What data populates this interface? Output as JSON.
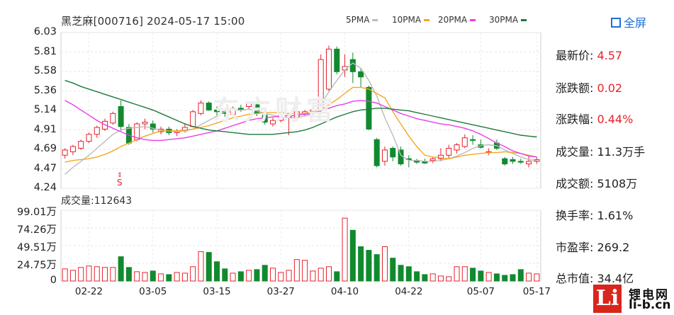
{
  "header": {
    "title": "黑芝麻[000716] 2024-05-17 15:00",
    "legend": [
      {
        "label": "5PMA",
        "color": "#bbbbbb"
      },
      {
        "label": "10PMA",
        "color": "#f5a623"
      },
      {
        "label": "20PMA",
        "color": "#e83ee8"
      },
      {
        "label": "30PMA",
        "color": "#1d7a3a"
      }
    ],
    "fullscreen_label": "全屏"
  },
  "watermark": "东方财富",
  "marker": "S",
  "stats": [
    {
      "label": "最新价:",
      "value": "4.57",
      "red": true
    },
    {
      "label": "涨跌额:",
      "value": "0.02",
      "red": true
    },
    {
      "label": "涨跌幅:",
      "value": "0.44%",
      "red": true
    },
    {
      "label": "成交量:",
      "value": "11.3万手",
      "red": false
    },
    {
      "label": "成交额:",
      "value": "5108万",
      "red": false
    },
    {
      "label": "换手率:",
      "value": "1.61%",
      "red": false
    },
    {
      "label": "市盈率:",
      "value": "269.2",
      "red": false
    },
    {
      "label": "总市值:",
      "value": "34.4亿",
      "red": false
    }
  ],
  "volume_title": "成交量:112643",
  "logo": {
    "glyph": "Li",
    "line1": "锂电网",
    "line2": "li-b.cn"
  },
  "chart_data": [
    {
      "type": "candlestick",
      "x_tick_labels": [
        "02-22",
        "03-05",
        "03-15",
        "03-27",
        "04-10",
        "04-22",
        "05-07",
        "05-17"
      ],
      "x_tick_index": [
        3,
        11,
        19,
        27,
        35,
        43,
        52,
        59
      ],
      "y_tick_labels": [
        "6.03",
        "5.81",
        "5.58",
        "5.36",
        "5.14",
        "4.91",
        "4.69",
        "4.47",
        "4.24"
      ],
      "ylim": [
        4.24,
        6.03
      ],
      "up_color": "#e8202a",
      "down_color": "#118a2e",
      "candles": [
        [
          4.62,
          4.7,
          4.58,
          4.68
        ],
        [
          4.66,
          4.74,
          4.62,
          4.72
        ],
        [
          4.7,
          4.8,
          4.68,
          4.78
        ],
        [
          4.78,
          4.88,
          4.76,
          4.86
        ],
        [
          4.86,
          4.96,
          4.82,
          4.94
        ],
        [
          4.92,
          5.04,
          4.9,
          5.01
        ],
        [
          4.99,
          5.12,
          4.97,
          5.1
        ],
        [
          5.18,
          5.25,
          4.9,
          4.95
        ],
        [
          4.94,
          4.98,
          4.74,
          4.76
        ],
        [
          4.8,
          5.0,
          4.78,
          4.98
        ],
        [
          4.98,
          5.04,
          4.92,
          5.0
        ],
        [
          4.98,
          5.02,
          4.88,
          4.92
        ],
        [
          4.89,
          4.95,
          4.86,
          4.92
        ],
        [
          4.92,
          4.95,
          4.85,
          4.88
        ],
        [
          4.88,
          4.92,
          4.84,
          4.9
        ],
        [
          4.9,
          4.99,
          4.88,
          4.94
        ],
        [
          4.95,
          5.14,
          4.94,
          5.12
        ],
        [
          5.1,
          5.25,
          5.08,
          5.22
        ],
        [
          5.22,
          5.24,
          5.13,
          5.14
        ],
        [
          5.14,
          5.18,
          5.05,
          5.12
        ],
        [
          5.12,
          5.16,
          5.06,
          5.1
        ],
        [
          5.09,
          5.18,
          5.08,
          5.16
        ],
        [
          5.16,
          5.2,
          5.12,
          5.14
        ],
        [
          5.18,
          5.24,
          5.15,
          5.22
        ],
        [
          5.2,
          5.22,
          5.07,
          5.1
        ],
        [
          5.08,
          5.12,
          4.97,
          5.0
        ],
        [
          4.98,
          5.05,
          4.95,
          5.02
        ],
        [
          5.02,
          5.1,
          5.0,
          5.06
        ],
        [
          5.06,
          5.1,
          4.85,
          5.08
        ],
        [
          5.06,
          5.14,
          5.04,
          5.12
        ],
        [
          5.1,
          5.14,
          5.07,
          5.12
        ],
        [
          5.12,
          5.18,
          5.1,
          5.14
        ],
        [
          5.14,
          5.78,
          5.1,
          5.72
        ],
        [
          5.38,
          5.88,
          5.35,
          5.84
        ],
        [
          5.84,
          5.87,
          5.55,
          5.58
        ],
        [
          5.6,
          5.78,
          5.52,
          5.64
        ],
        [
          5.72,
          5.8,
          5.45,
          5.58
        ],
        [
          5.58,
          5.62,
          5.4,
          5.52
        ],
        [
          5.4,
          5.42,
          4.91,
          4.92
        ],
        [
          4.8,
          4.82,
          4.48,
          4.5
        ],
        [
          4.55,
          4.72,
          4.5,
          4.68
        ],
        [
          4.7,
          4.72,
          4.55,
          4.6
        ],
        [
          4.68,
          4.72,
          4.5,
          4.52
        ],
        [
          4.58,
          4.62,
          4.48,
          4.57
        ],
        [
          4.56,
          4.58,
          4.52,
          4.54
        ],
        [
          4.55,
          4.58,
          4.52,
          4.53
        ],
        [
          4.56,
          4.6,
          4.53,
          4.58
        ],
        [
          4.58,
          4.7,
          4.55,
          4.62
        ],
        [
          4.62,
          4.74,
          4.58,
          4.7
        ],
        [
          4.68,
          4.76,
          4.64,
          4.74
        ],
        [
          4.72,
          4.86,
          4.7,
          4.82
        ],
        [
          4.8,
          4.85,
          4.74,
          4.79
        ],
        [
          4.74,
          4.8,
          4.7,
          4.71
        ],
        [
          4.66,
          4.7,
          4.62,
          4.66
        ],
        [
          4.76,
          4.8,
          4.68,
          4.7
        ],
        [
          4.58,
          4.6,
          4.5,
          4.52
        ],
        [
          4.57,
          4.6,
          4.52,
          4.55
        ],
        [
          4.55,
          4.58,
          4.52,
          4.54
        ],
        [
          4.52,
          4.62,
          4.48,
          4.55
        ],
        [
          4.55,
          4.6,
          4.52,
          4.57
        ]
      ],
      "ma_series": [
        {
          "name": "5PMA",
          "color": "#bbbbbb",
          "values": [
            4.4,
            4.48,
            4.55,
            4.62,
            4.7,
            4.78,
            4.86,
            4.91,
            4.93,
            4.94,
            4.95,
            4.93,
            4.91,
            4.9,
            4.89,
            4.9,
            4.92,
            4.97,
            5.02,
            5.07,
            5.12,
            5.14,
            5.14,
            5.15,
            5.13,
            5.1,
            5.08,
            5.06,
            5.05,
            5.05,
            5.07,
            5.09,
            5.2,
            5.35,
            5.48,
            5.6,
            5.68,
            5.62,
            5.48,
            5.3,
            5.05,
            4.85,
            4.62,
            4.56,
            4.56,
            4.55,
            4.55,
            4.56,
            4.58,
            4.61,
            4.65,
            4.7,
            4.73,
            4.74,
            4.73,
            4.68,
            4.64,
            4.6,
            4.57,
            4.56
          ]
        },
        {
          "name": "10PMA",
          "color": "#f5a623",
          "values": [
            4.54,
            4.56,
            4.57,
            4.58,
            4.6,
            4.63,
            4.67,
            4.72,
            4.76,
            4.8,
            4.84,
            4.87,
            4.9,
            4.9,
            4.9,
            4.91,
            4.92,
            4.94,
            4.96,
            4.99,
            5.02,
            5.05,
            5.07,
            5.09,
            5.1,
            5.11,
            5.11,
            5.11,
            5.1,
            5.1,
            5.1,
            5.11,
            5.14,
            5.2,
            5.26,
            5.33,
            5.4,
            5.4,
            5.38,
            5.33,
            5.28,
            5.12,
            4.98,
            4.84,
            4.72,
            4.62,
            4.6,
            4.59,
            4.58,
            4.6,
            4.62,
            4.63,
            4.64,
            4.65,
            4.65,
            4.66,
            4.65,
            4.64,
            4.62,
            4.6
          ]
        },
        {
          "name": "20PMA",
          "color": "#e83ee8",
          "values": [
            5.25,
            5.2,
            5.14,
            5.08,
            5.02,
            4.97,
            4.93,
            4.89,
            4.85,
            4.82,
            4.8,
            4.79,
            4.79,
            4.8,
            4.81,
            4.82,
            4.84,
            4.86,
            4.88,
            4.9,
            4.93,
            4.96,
            4.99,
            5.02,
            5.04,
            5.05,
            5.06,
            5.07,
            5.07,
            5.08,
            5.09,
            5.1,
            5.13,
            5.16,
            5.19,
            5.21,
            5.24,
            5.25,
            5.24,
            5.22,
            5.18,
            5.14,
            5.1,
            5.07,
            5.04,
            5.02,
            5.0,
            4.98,
            4.97,
            4.95,
            4.93,
            4.9,
            4.86,
            4.81,
            4.76,
            4.72,
            4.67,
            4.64,
            4.61,
            4.6
          ]
        },
        {
          "name": "30PMA",
          "color": "#1d7a3a",
          "values": [
            5.48,
            5.45,
            5.41,
            5.38,
            5.35,
            5.32,
            5.29,
            5.26,
            5.23,
            5.2,
            5.17,
            5.14,
            5.1,
            5.06,
            5.02,
            4.98,
            4.95,
            4.93,
            4.91,
            4.9,
            4.89,
            4.88,
            4.87,
            4.86,
            4.86,
            4.86,
            4.86,
            4.87,
            4.88,
            4.89,
            4.91,
            4.94,
            4.98,
            5.02,
            5.06,
            5.09,
            5.12,
            5.14,
            5.15,
            5.16,
            5.16,
            5.15,
            5.14,
            5.13,
            5.11,
            5.09,
            5.07,
            5.05,
            5.03,
            5.01,
            4.99,
            4.97,
            4.95,
            4.93,
            4.91,
            4.89,
            4.87,
            4.85,
            4.84,
            4.83
          ]
        }
      ]
    },
    {
      "type": "bar",
      "title": "成交量:112643",
      "y_tick_labels": [
        "99.01万",
        "74.26万",
        "49.51万",
        "24.75万",
        "0"
      ],
      "ylim": [
        0,
        99.01
      ],
      "unit": "万",
      "values": [
        17,
        15,
        19,
        21,
        20,
        19,
        19,
        34,
        19,
        13,
        12,
        14,
        10,
        9,
        12,
        11,
        20,
        41,
        40,
        27,
        17,
        11,
        13,
        15,
        16,
        22,
        18,
        12,
        15,
        30,
        29,
        14,
        18,
        20,
        13,
        88,
        71,
        48,
        43,
        37,
        48,
        32,
        22,
        20,
        13,
        9,
        10,
        7,
        6,
        20,
        20,
        18,
        14,
        12,
        10,
        8,
        9,
        16,
        11,
        10
      ],
      "colors_by_candle": true
    }
  ]
}
